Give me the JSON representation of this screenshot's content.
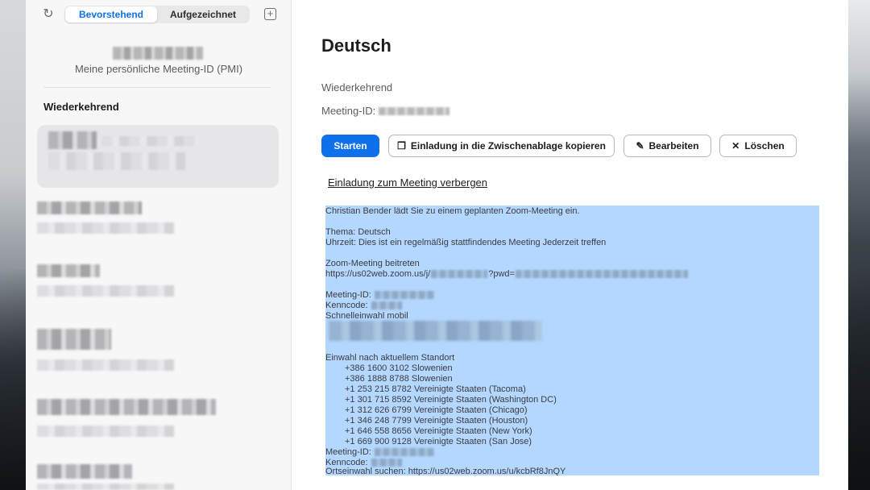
{
  "sidebar": {
    "tabs": [
      {
        "label": "Bevorstehend",
        "active": true
      },
      {
        "label": "Aufgezeichnet",
        "active": false
      }
    ],
    "refresh_icon": "refresh-icon",
    "add_icon": "plus-icon",
    "pmi_label": "Meine persönliche Meeting-ID (PMI)",
    "section_title": "Wiederkehrend"
  },
  "meeting": {
    "topic": "Deutsch",
    "recurrence": "Wiederkehrend",
    "meeting_id_label": "Meeting-ID:"
  },
  "actions": {
    "start": "Starten",
    "copy": "Einladung in die Zwischenablage kopieren",
    "edit": "Bearbeiten",
    "delete": "Löschen",
    "hide_invitation": "Einladung zum Meeting verbergen"
  },
  "invitation": {
    "line1": "Christian Bender lädt Sie zu einem geplanten Zoom-Meeting ein.",
    "topic": "Thema: Deutsch",
    "time": "Uhrzeit: Dies ist ein regelmäßig stattfindendes Meeting Jederzeit treffen",
    "join_heading": "Zoom-Meeting beitreten",
    "join_url_prefix": "https://us02web.zoom.us/j/",
    "join_url_pwd": "?pwd=",
    "meeting_id": "Meeting-ID:",
    "passcode": "Kenncode:",
    "mobile": "Schnelleinwahl mobil",
    "dial_heading": "Einwahl nach aktuellem Standort",
    "numbers": [
      "+386 1600 3102 Slowenien",
      "+386 1888 8788 Slowenien",
      "+1 253 215 8782 Vereinigte Staaten (Tacoma)",
      "+1 301 715 8592 Vereinigte Staaten (Washington DC)",
      "+1 312 626 6799 Vereinigte Staaten (Chicago)",
      "+1 346 248 7799 Vereinigte Staaten (Houston)",
      "+1 646 558 8656 Vereinigte Staaten (New York)",
      "+1 669 900 9128 Vereinigte Staaten (San Jose)"
    ],
    "meeting_id2": "Meeting-ID:",
    "passcode2": "Kenncode:",
    "local_dial": "Ortseinwahl suchen: https://us02web.zoom.us/u/kcbRf8JnQY"
  },
  "colors": {
    "accent": "#0e71eb",
    "selection": "#b3d7ff"
  }
}
